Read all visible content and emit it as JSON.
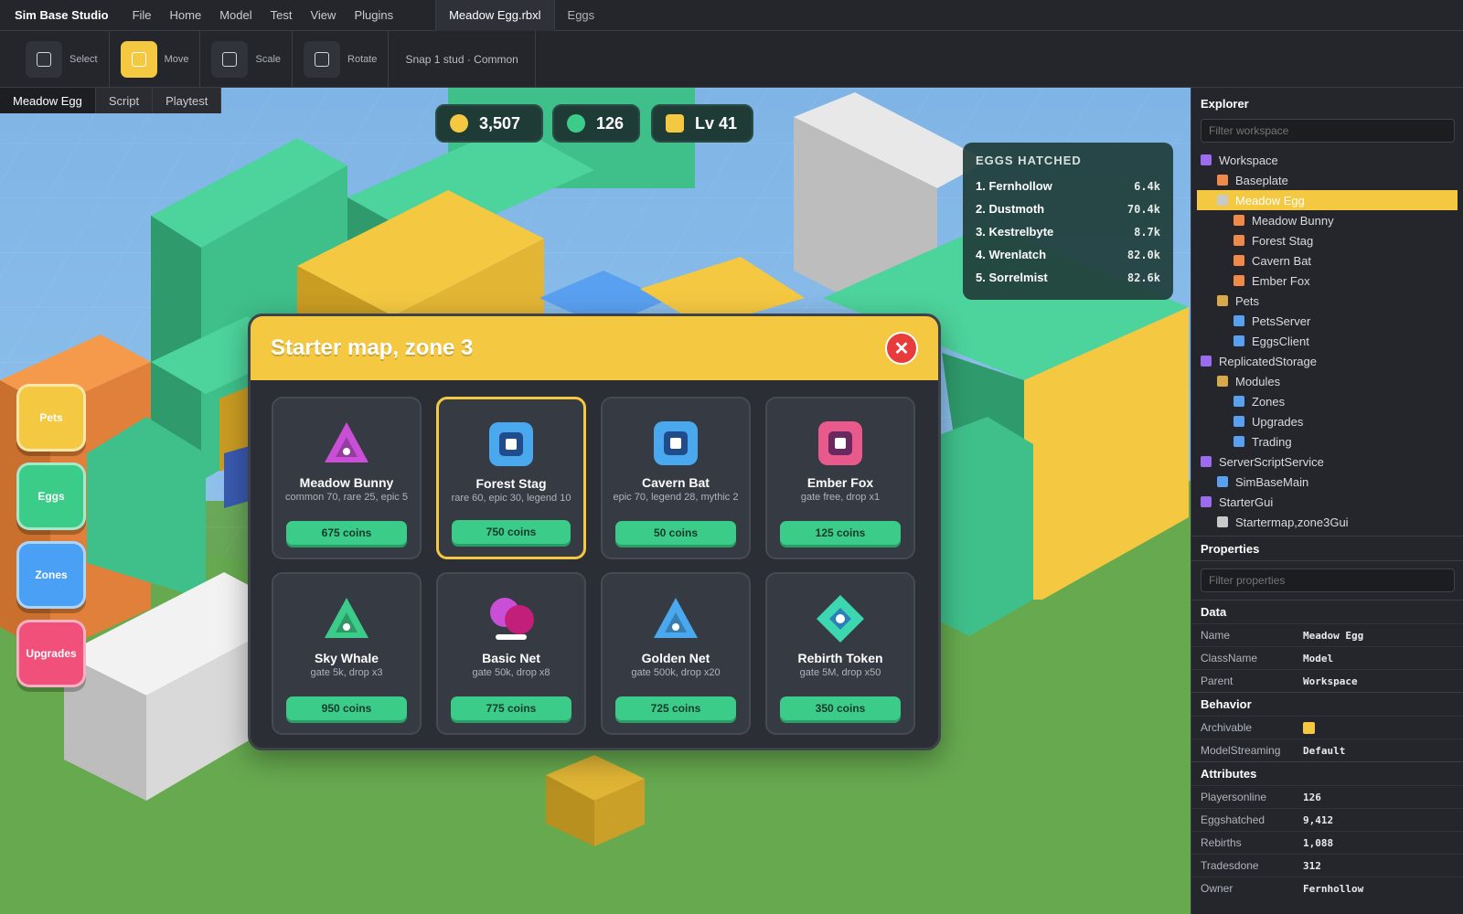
{
  "app": {
    "brand": "Sim Base Studio",
    "menu": [
      "File",
      "Home",
      "Model",
      "Test",
      "View",
      "Plugins"
    ],
    "doc_tab_active": "Meadow Egg.rbxl",
    "doc_tab_other": "Eggs"
  },
  "toolbar": {
    "tools": [
      "Select",
      "Move",
      "Scale",
      "Rotate"
    ],
    "active_tool": "Move",
    "snap": "Snap 1 stud · Common"
  },
  "viewport": {
    "tabs": [
      "Meadow Egg",
      "Script",
      "Playtest"
    ],
    "active_tab": "Meadow Egg"
  },
  "hud": {
    "coins": "3,507",
    "gems": "126",
    "level": "Lv 41"
  },
  "leaderboard": {
    "title": "EGGS HATCHED",
    "rows": [
      {
        "name": "1. Fernhollow",
        "value": "6.4k"
      },
      {
        "name": "2. Dustmoth",
        "value": "70.4k"
      },
      {
        "name": "3. Kestrelbyte",
        "value": "8.7k"
      },
      {
        "name": "4. Wrenlatch",
        "value": "82.0k"
      },
      {
        "name": "5. Sorrelmist",
        "value": "82.6k"
      }
    ]
  },
  "side_buttons": [
    "Pets",
    "Eggs",
    "Zones",
    "Upgrades"
  ],
  "modal": {
    "title": "Starter map, zone 3",
    "close": "✕",
    "items": [
      {
        "name": "Meadow Bunny",
        "desc": "common 70, rare 25, epic 5",
        "price": "675 coins",
        "icon": "triangle-icon",
        "color": "#c94fd6"
      },
      {
        "name": "Forest Stag",
        "desc": "rare 60, epic 30, legend 10",
        "price": "750 coins",
        "icon": "square-icon",
        "color": "#4aa8ee",
        "selected": true
      },
      {
        "name": "Cavern Bat",
        "desc": "epic 70, legend 28, mythic 2",
        "price": "50 coins",
        "icon": "square-icon",
        "color": "#4aa8ee"
      },
      {
        "name": "Ember Fox",
        "desc": "gate free, drop x1",
        "price": "125 coins",
        "icon": "square-icon",
        "color": "#e85a8c"
      },
      {
        "name": "Sky Whale",
        "desc": "gate 5k, drop x3",
        "price": "950 coins",
        "icon": "triangle-icon",
        "color": "#3ccc8a"
      },
      {
        "name": "Basic Net",
        "desc": "gate 50k, drop x8",
        "price": "775 coins",
        "icon": "circles-icon",
        "color": "#c94fd6"
      },
      {
        "name": "Golden Net",
        "desc": "gate 500k, drop x20",
        "price": "725 coins",
        "icon": "triangle-icon",
        "color": "#4aa8ee"
      },
      {
        "name": "Rebirth Token",
        "desc": "gate 5M, drop x50",
        "price": "350 coins",
        "icon": "diamond-icon",
        "color": "#3cd6b0"
      }
    ]
  },
  "explorer": {
    "title": "Explorer",
    "filter_placeholder": "Filter workspace",
    "items": [
      {
        "label": "Workspace",
        "depth": 0,
        "color": "#9b6cf0"
      },
      {
        "label": "Baseplate",
        "depth": 1,
        "color": "#f08a4b"
      },
      {
        "label": "Meadow Egg",
        "depth": 1,
        "color": "#c9c9c9",
        "selected": true
      },
      {
        "label": "Meadow Bunny",
        "depth": 2,
        "color": "#f08a4b"
      },
      {
        "label": "Forest Stag",
        "depth": 2,
        "color": "#f08a4b"
      },
      {
        "label": "Cavern Bat",
        "depth": 2,
        "color": "#f08a4b"
      },
      {
        "label": "Ember Fox",
        "depth": 2,
        "color": "#f08a4b"
      },
      {
        "label": "Pets",
        "depth": 1,
        "color": "#d9a84a"
      },
      {
        "label": "PetsServer",
        "depth": 2,
        "color": "#5aa0f0"
      },
      {
        "label": "EggsClient",
        "depth": 2,
        "color": "#5aa0f0"
      },
      {
        "label": "ReplicatedStorage",
        "depth": 0,
        "color": "#9b6cf0"
      },
      {
        "label": "Modules",
        "depth": 1,
        "color": "#d9a84a"
      },
      {
        "label": "Zones",
        "depth": 2,
        "color": "#5aa0f0"
      },
      {
        "label": "Upgrades",
        "depth": 2,
        "color": "#5aa0f0"
      },
      {
        "label": "Trading",
        "depth": 2,
        "color": "#5aa0f0"
      },
      {
        "label": "ServerScriptService",
        "depth": 0,
        "color": "#9b6cf0"
      },
      {
        "label": "SimBaseMain",
        "depth": 1,
        "color": "#5aa0f0"
      },
      {
        "label": "StarterGui",
        "depth": 0,
        "color": "#9b6cf0"
      },
      {
        "label": "Startermap,zone3Gui",
        "depth": 1,
        "color": "#c9c9c9"
      }
    ]
  },
  "properties": {
    "title": "Properties",
    "filter_placeholder": "Filter properties",
    "sections": [
      {
        "title": "Data",
        "rows": [
          {
            "key": "Name",
            "value": "Meadow Egg"
          },
          {
            "key": "ClassName",
            "value": "Model"
          },
          {
            "key": "Parent",
            "value": "Workspace"
          }
        ]
      },
      {
        "title": "Behavior",
        "rows": [
          {
            "key": "Archivable",
            "value": "",
            "checkbox": true
          },
          {
            "key": "ModelStreaming",
            "value": "Default"
          }
        ]
      },
      {
        "title": "Attributes",
        "rows": [
          {
            "key": "Playersonline",
            "value": "126"
          },
          {
            "key": "Eggshatched",
            "value": "9,412"
          },
          {
            "key": "Rebirths",
            "value": "1,088"
          },
          {
            "key": "Tradesdone",
            "value": "312"
          },
          {
            "key": "Owner",
            "value": "Fernhollow"
          }
        ]
      }
    ]
  }
}
